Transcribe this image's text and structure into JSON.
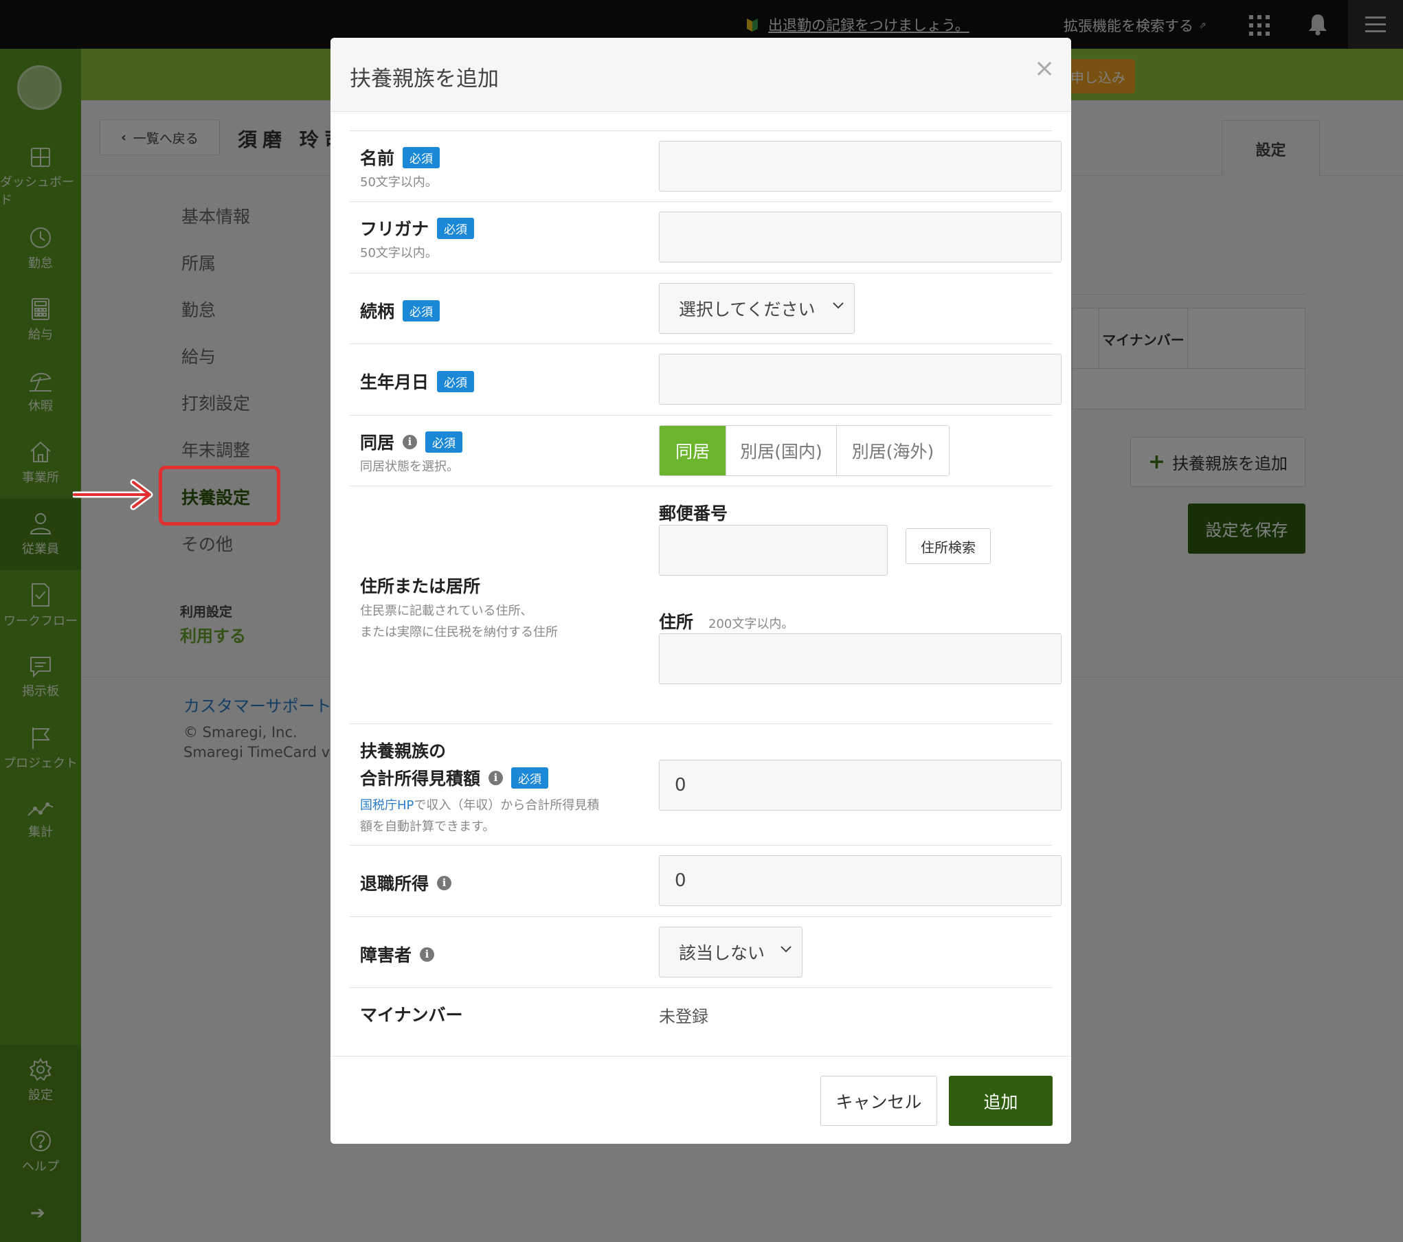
{
  "topbar": {
    "notice": "出退勤の記録をつけましょう。",
    "extension_search": "拡張機能を検索する",
    "icons": [
      "beginner-leaf-icon",
      "external-link-icon",
      "apps-grid-icon",
      "bell-icon",
      "hamburger-menu-icon"
    ]
  },
  "sidebar": {
    "items": [
      {
        "label": "ダッシュボード",
        "icon": "dashboard-icon"
      },
      {
        "label": "勤怠",
        "icon": "clock-icon"
      },
      {
        "label": "給与",
        "icon": "calculator-icon"
      },
      {
        "label": "休暇",
        "icon": "umbrella-icon"
      },
      {
        "label": "事業所",
        "icon": "home-icon"
      },
      {
        "label": "従業員",
        "icon": "person-icon"
      },
      {
        "label": "ワークフロー",
        "icon": "document-check-icon"
      },
      {
        "label": "掲示板",
        "icon": "chat-icon"
      },
      {
        "label": "プロジェクト",
        "icon": "flag-icon"
      },
      {
        "label": "集計",
        "icon": "chart-line-icon"
      }
    ],
    "bottom": [
      {
        "label": "設定",
        "icon": "gear-icon"
      },
      {
        "label": "ヘルプ",
        "icon": "help-icon"
      }
    ]
  },
  "background": {
    "banner_button": "申し込み",
    "back_button": "一覧へ戻る",
    "employee_name": "須磨 玲司",
    "settings_tab": "設定",
    "nav": [
      "基本情報",
      "所属",
      "勤怠",
      "給与",
      "打刻設定",
      "年末調整",
      "扶養設定",
      "その他"
    ],
    "use_label": "利用設定",
    "use_value": "利用する",
    "table_header": "マイナンバー",
    "add_family_button": "扶養親族を追加",
    "save_button": "設定を保存",
    "support_link": "カスタマーサポート",
    "copyright": "© Smaregi, Inc.",
    "product": "Smaregi TimeCard ve"
  },
  "modal": {
    "title": "扶養親族を追加",
    "close": "×",
    "required_badge": "必須",
    "name": {
      "label": "名前",
      "hint": "50文字以内。",
      "value": ""
    },
    "kana": {
      "label": "フリガナ",
      "hint": "50文字以内。",
      "value": ""
    },
    "relation": {
      "label": "続柄",
      "selected": "選択してください"
    },
    "birthdate": {
      "label": "生年月日",
      "value": ""
    },
    "cohabit": {
      "label": "同居",
      "hint": "同居状態を選択。",
      "options": [
        "同居",
        "別居(国内)",
        "別居(海外)"
      ],
      "selected": "同居"
    },
    "address": {
      "label": "住所または居所",
      "hint1": "住民票に記載されている住所、",
      "hint2": "または実際に住民税を納付する住所",
      "postal_label": "郵便番号",
      "postal_value": "",
      "search_button": "住所検索",
      "address_label": "住所",
      "address_hint": "200文字以内。",
      "address_value": ""
    },
    "income": {
      "label1": "扶養親族の",
      "label2": "合計所得見積額",
      "hint_link": "国税庁HP",
      "hint_rest": "で収入（年収）から合計所得見積",
      "hint_line2": "額を自動計算できます。",
      "value": "0"
    },
    "retirement": {
      "label": "退職所得",
      "value": "0"
    },
    "disability": {
      "label": "障害者",
      "selected": "該当しない"
    },
    "mynumber": {
      "label": "マイナンバー",
      "value": "未登録"
    },
    "cancel_button": "キャンセル",
    "add_button": "追加"
  },
  "colors": {
    "sidebar": "#5b9a22",
    "banner": "#8fc63e",
    "primary_button": "#2e5e0e",
    "required_badge": "#1a88d6",
    "selected_segment": "#6bb52d",
    "highlight": "#e03030"
  }
}
